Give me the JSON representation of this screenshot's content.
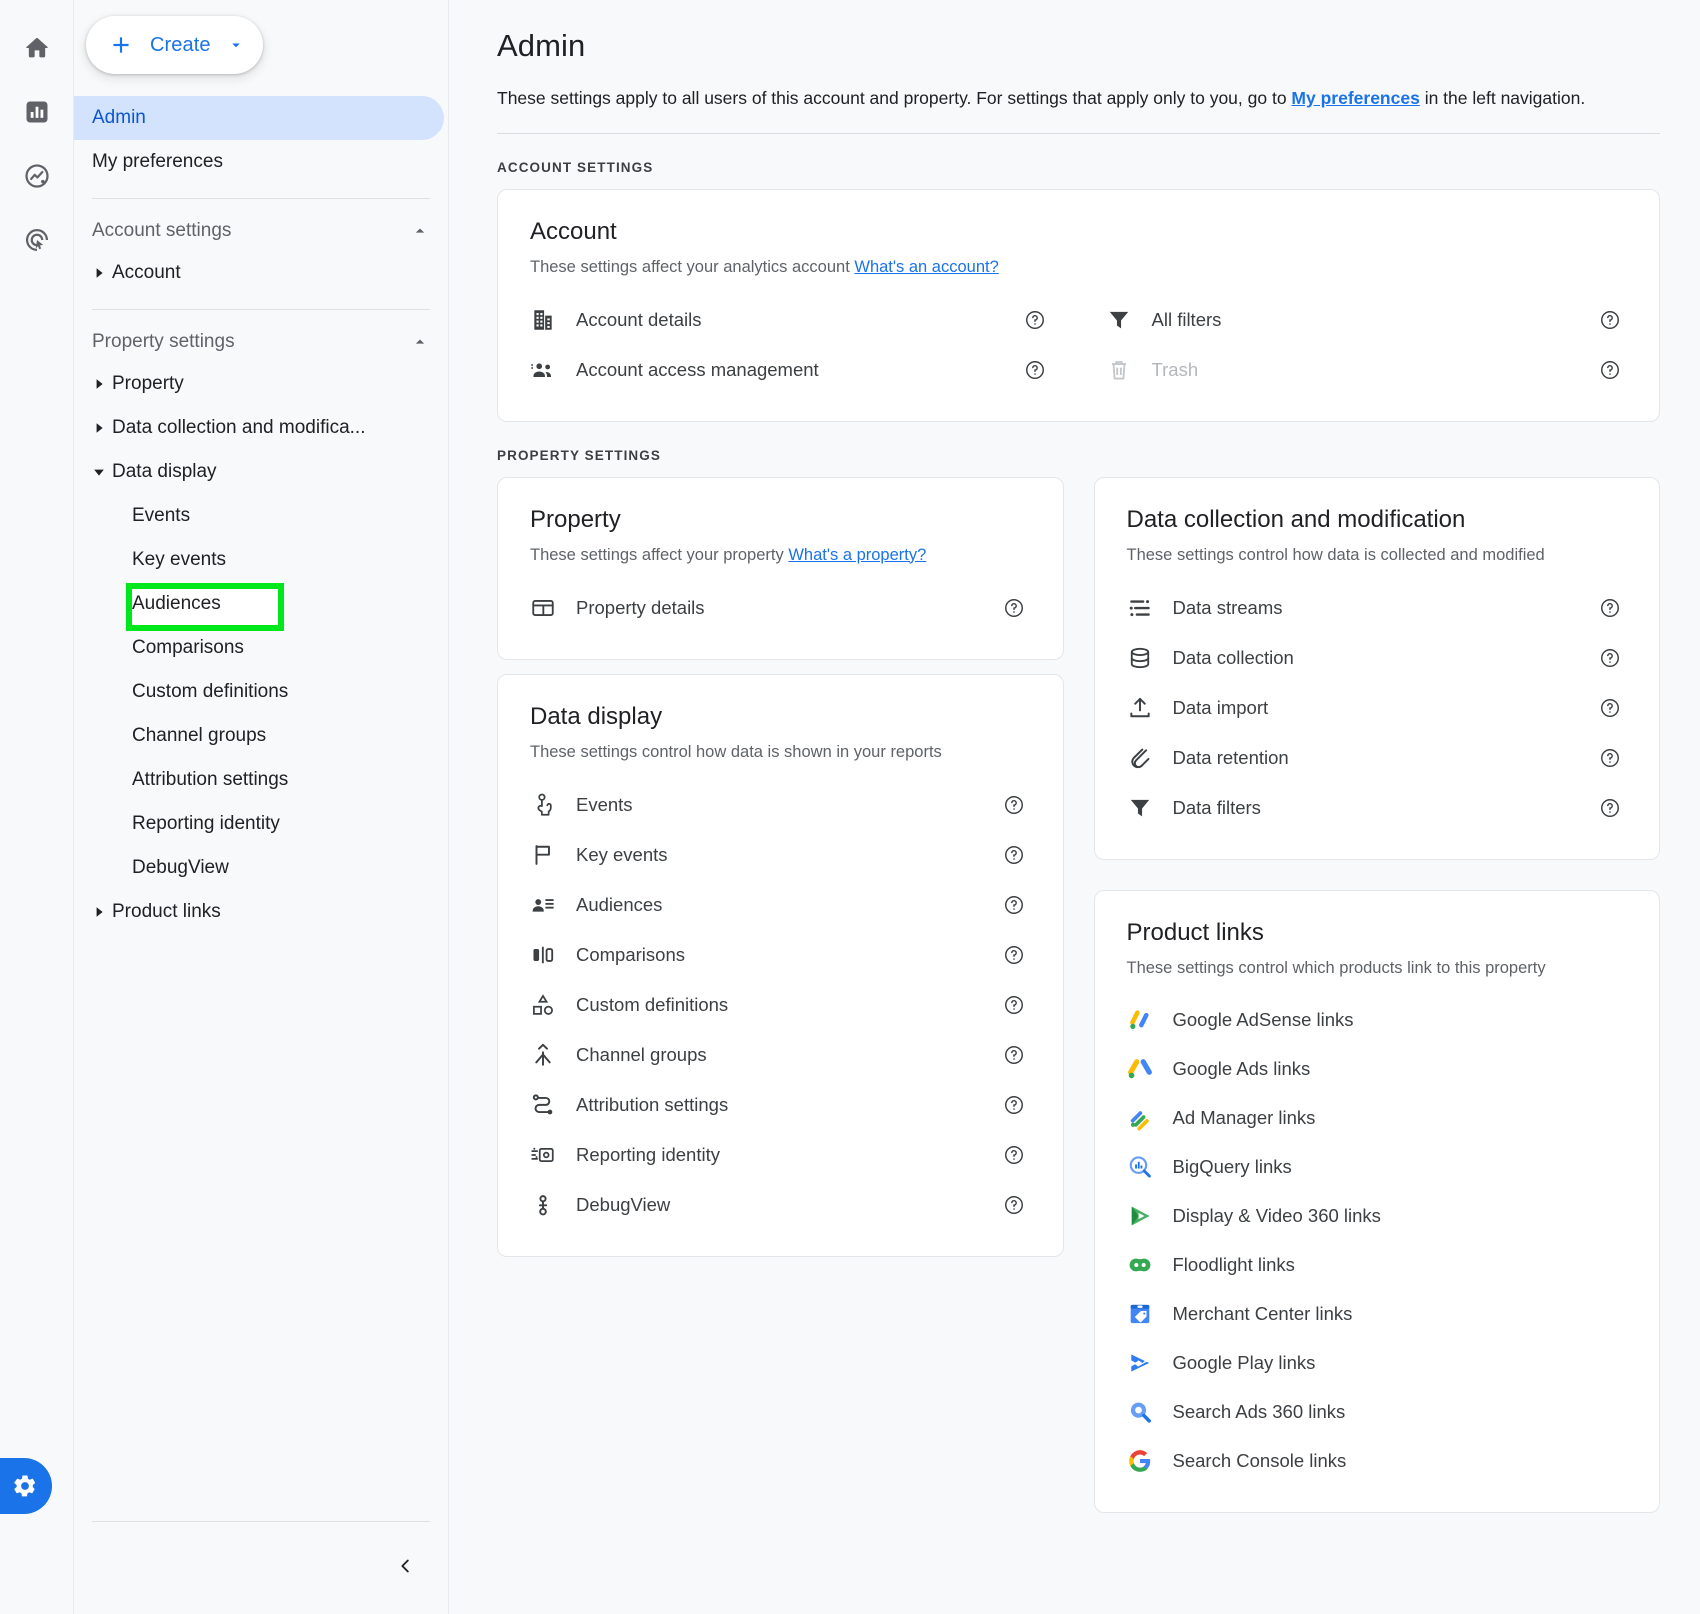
{
  "rail": {
    "items": [
      {
        "name": "home-icon",
        "label": "Home"
      },
      {
        "name": "reports-icon",
        "label": "Reports"
      },
      {
        "name": "explore-icon",
        "label": "Explore"
      },
      {
        "name": "advertising-icon",
        "label": "Advertising"
      }
    ],
    "gear_label": "Admin settings"
  },
  "sidebar": {
    "create_label": "Create",
    "nav": [
      {
        "label": "Admin",
        "active": true
      },
      {
        "label": "My preferences",
        "active": false
      }
    ],
    "groups": [
      {
        "label": "Account settings",
        "expanded": true,
        "trees": [
          {
            "label": "Account",
            "expanded": false,
            "leaves": []
          }
        ]
      },
      {
        "label": "Property settings",
        "expanded": true,
        "trees": [
          {
            "label": "Property",
            "expanded": false,
            "leaves": []
          },
          {
            "label": "Data collection and modifica...",
            "expanded": false,
            "leaves": []
          },
          {
            "label": "Data display",
            "expanded": true,
            "leaves": [
              {
                "label": "Events",
                "highlighted": false
              },
              {
                "label": "Key events",
                "highlighted": false
              },
              {
                "label": "Audiences",
                "highlighted": true
              },
              {
                "label": "Comparisons",
                "highlighted": false
              },
              {
                "label": "Custom definitions",
                "highlighted": false
              },
              {
                "label": "Channel groups",
                "highlighted": false
              },
              {
                "label": "Attribution settings",
                "highlighted": false
              },
              {
                "label": "Reporting identity",
                "highlighted": false
              },
              {
                "label": "DebugView",
                "highlighted": false
              }
            ]
          },
          {
            "label": "Product links",
            "expanded": false,
            "leaves": []
          }
        ]
      }
    ],
    "collapse_label": "Collapse navigation"
  },
  "main": {
    "title": "Admin",
    "subtitle_before": "These settings apply to all users of this account and property. For settings that apply only to you, go to ",
    "subtitle_link": "My preferences",
    "subtitle_after": " in the left navigation.",
    "account_settings_label": "ACCOUNT SETTINGS",
    "property_settings_label": "PROPERTY SETTINGS",
    "account_card": {
      "title": "Account",
      "sub_text": "These settings affect your analytics account ",
      "sub_link": "What's an account?",
      "left_items": [
        {
          "label": "Account details",
          "icon": "building-icon",
          "disabled": false,
          "help": "help-icon"
        },
        {
          "label": "Account access management",
          "icon": "people-icon",
          "disabled": false,
          "help": "help-icon"
        }
      ],
      "right_items": [
        {
          "label": "All filters",
          "icon": "filter-icon",
          "disabled": false,
          "help": "help-icon"
        },
        {
          "label": "Trash",
          "icon": "trash-icon",
          "disabled": true,
          "help": "help-icon"
        }
      ]
    },
    "property_card": {
      "title": "Property",
      "sub_text": "These settings affect your property ",
      "sub_link": "What's a property?",
      "items": [
        {
          "label": "Property details",
          "icon": "property-details-icon",
          "help": "help-icon"
        }
      ]
    },
    "data_display_card": {
      "title": "Data display",
      "sub_text": "These settings control how data is shown in your reports",
      "items": [
        {
          "label": "Events",
          "icon": "touch-icon",
          "help": "help-icon"
        },
        {
          "label": "Key events",
          "icon": "flag-icon",
          "help": "help-icon"
        },
        {
          "label": "Audiences",
          "icon": "audience-icon",
          "help": "help-icon"
        },
        {
          "label": "Comparisons",
          "icon": "comparison-bars-icon",
          "help": "help-icon"
        },
        {
          "label": "Custom definitions",
          "icon": "shapes-icon",
          "help": "help-icon"
        },
        {
          "label": "Channel groups",
          "icon": "merge-arrows-icon",
          "help": "help-icon"
        },
        {
          "label": "Attribution settings",
          "icon": "attribution-path-icon",
          "help": "help-icon"
        },
        {
          "label": "Reporting identity",
          "icon": "reporting-identity-icon",
          "help": "help-icon"
        },
        {
          "label": "DebugView",
          "icon": "debug-bug-icon",
          "help": "help-icon"
        }
      ]
    },
    "data_collection_card": {
      "title": "Data collection and modification",
      "sub_text": "These settings control how data is collected and modified",
      "items": [
        {
          "label": "Data streams",
          "icon": "data-streams-icon",
          "help": "help-icon"
        },
        {
          "label": "Data collection",
          "icon": "database-icon",
          "help": "help-icon"
        },
        {
          "label": "Data import",
          "icon": "upload-icon",
          "help": "help-icon"
        },
        {
          "label": "Data retention",
          "icon": "magnet-icon",
          "help": "help-icon"
        },
        {
          "label": "Data filters",
          "icon": "filter-icon",
          "help": "help-icon"
        }
      ]
    },
    "product_links_card": {
      "title": "Product links",
      "sub_text": "These settings control which products link to this property",
      "items": [
        {
          "label": "Google AdSense links",
          "icon": "adsense-icon"
        },
        {
          "label": "Google Ads links",
          "icon": "google-ads-icon"
        },
        {
          "label": "Ad Manager links",
          "icon": "ad-manager-icon"
        },
        {
          "label": "BigQuery links",
          "icon": "bigquery-icon"
        },
        {
          "label": "Display & Video 360 links",
          "icon": "dv360-icon"
        },
        {
          "label": "Floodlight links",
          "icon": "floodlight-icon"
        },
        {
          "label": "Merchant Center links",
          "icon": "merchant-center-icon"
        },
        {
          "label": "Google Play links",
          "icon": "google-play-icon"
        },
        {
          "label": "Search Ads 360 links",
          "icon": "search-ads-360-icon"
        },
        {
          "label": "Search Console links",
          "icon": "google-g-icon"
        }
      ]
    }
  },
  "colors": {
    "accent": "#1a73e8",
    "active_bg": "#d3e3fd",
    "highlight": "#00e81b",
    "page_bg": "#f8f9fa",
    "text": "#202124",
    "muted": "#5f6368"
  }
}
